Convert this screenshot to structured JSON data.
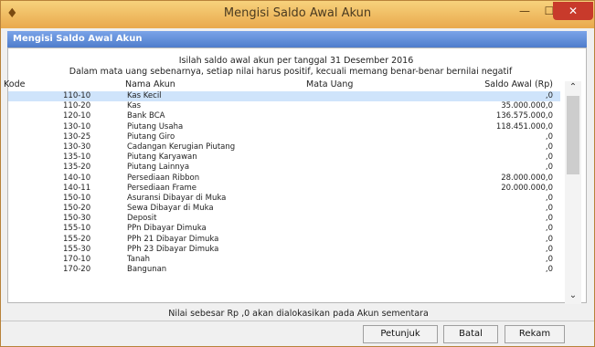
{
  "window": {
    "title": "Mengisi Saldo Awal Akun",
    "minimize_glyph": "—",
    "maximize_glyph": "☐",
    "close_glyph": "✕",
    "icon": "app-icon"
  },
  "panel": {
    "header": "Mengisi Saldo Awal Akun",
    "info_line1": "Isilah saldo awal akun per tanggal 31 Desember 2016",
    "info_line2": "Dalam mata uang sebenarnya, setiap nilai harus positif, kecuali memang benar-benar bernilai negatif"
  },
  "table": {
    "columns": {
      "kode": "Kode",
      "nama": "Nama Akun",
      "mata_uang": "Mata Uang",
      "saldo": "Saldo Awal (Rp)"
    },
    "rows": [
      {
        "kode": "110-10",
        "nama": "Kas Kecil",
        "saldo": ",0"
      },
      {
        "kode": "110-20",
        "nama": "Kas",
        "saldo": "35.000.000,0"
      },
      {
        "kode": "120-10",
        "nama": "Bank BCA",
        "saldo": "136.575.000,0"
      },
      {
        "kode": "130-10",
        "nama": "Piutang Usaha",
        "saldo": "118.451.000,0"
      },
      {
        "kode": "130-25",
        "nama": "Piutang Giro",
        "saldo": ",0"
      },
      {
        "kode": "130-30",
        "nama": "Cadangan Kerugian Piutang",
        "saldo": ",0"
      },
      {
        "kode": "135-10",
        "nama": "Piutang Karyawan",
        "saldo": ",0"
      },
      {
        "kode": "135-20",
        "nama": "Piutang Lainnya",
        "saldo": ",0"
      },
      {
        "kode": "140-10",
        "nama": "Persediaan Ribbon",
        "saldo": "28.000.000,0"
      },
      {
        "kode": "140-11",
        "nama": "Persediaan Frame",
        "saldo": "20.000.000,0"
      },
      {
        "kode": "150-10",
        "nama": "Asuransi Dibayar di Muka",
        "saldo": ",0"
      },
      {
        "kode": "150-20",
        "nama": "Sewa Dibayar di Muka",
        "saldo": ",0"
      },
      {
        "kode": "150-30",
        "nama": "Deposit",
        "saldo": ",0"
      },
      {
        "kode": "155-10",
        "nama": "PPn Dibayar Dimuka",
        "saldo": ",0"
      },
      {
        "kode": "155-20",
        "nama": "PPh 21 Dibayar Dimuka",
        "saldo": ",0"
      },
      {
        "kode": "155-30",
        "nama": "PPh 23 Dibayar Dimuka",
        "saldo": ",0"
      },
      {
        "kode": "170-10",
        "nama": "Tanah",
        "saldo": ",0"
      },
      {
        "kode": "170-20",
        "nama": "Bangunan",
        "saldo": ",0"
      }
    ]
  },
  "scrollbar": {
    "up_glyph": "⌃",
    "down_glyph": "⌄"
  },
  "footer": {
    "note": "Nilai sebesar Rp ,0 akan dialokasikan pada Akun sementara",
    "buttons": {
      "petunjuk": "Petunjuk",
      "batal": "Batal",
      "rekam": "Rekam"
    }
  },
  "colors": {
    "titlebar": "#e9a94d",
    "header": "#4f7dcc",
    "selected_row": "#cfe4fb",
    "close": "#c83a2b"
  }
}
